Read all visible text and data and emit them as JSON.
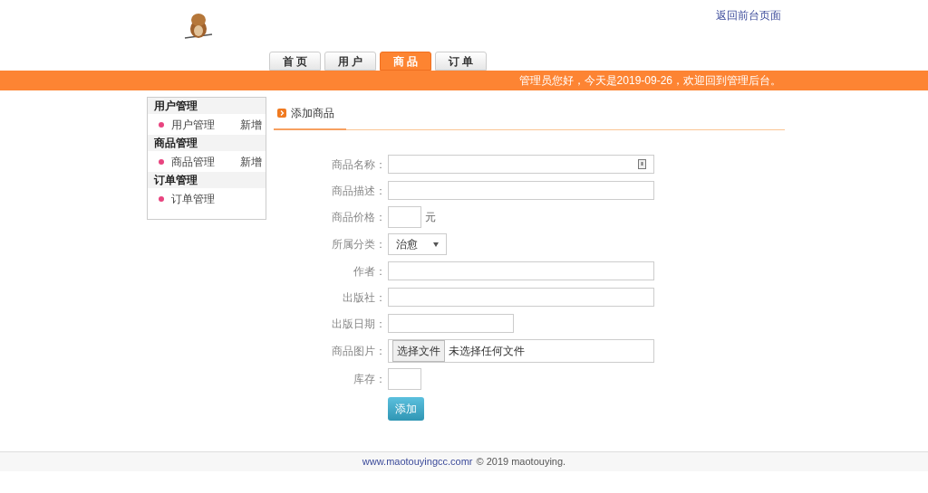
{
  "header": {
    "back_link": "返回前台页面"
  },
  "tabs": [
    {
      "label": "首 页",
      "selected": false
    },
    {
      "label": "用 户",
      "selected": false
    },
    {
      "label": "商 品",
      "selected": true
    },
    {
      "label": "订 单",
      "selected": false
    }
  ],
  "banner": "管理员您好，今天是2019-09-26，欢迎回到管理后台。",
  "sidebar": [
    {
      "title": "用户管理",
      "items": [
        {
          "label": "用户管理",
          "action": "新增"
        }
      ]
    },
    {
      "title": "商品管理",
      "items": [
        {
          "label": "商品管理",
          "action": "新增"
        }
      ]
    },
    {
      "title": "订单管理",
      "items": [
        {
          "label": "订单管理"
        }
      ]
    }
  ],
  "section_title": "添加商品",
  "form": [
    {
      "kind": "text",
      "label": "商品名称："
    },
    {
      "kind": "text",
      "label": "商品描述："
    },
    {
      "kind": "short",
      "label": "商品价格：",
      "unit": "元"
    },
    {
      "kind": "select",
      "label": "所属分类：",
      "value": "治愈"
    },
    {
      "kind": "text",
      "label": "作者："
    },
    {
      "kind": "text",
      "label": "出版社："
    },
    {
      "kind": "date",
      "label": "出版日期："
    },
    {
      "kind": "file",
      "label": "商品图片：",
      "button": "选择文件",
      "status": "未选择任何文件"
    },
    {
      "kind": "short",
      "label": "库存："
    }
  ],
  "submit": "添加",
  "footer": {
    "link": "www.maotouyingcc.comr",
    "text": "© 2019 maotouying."
  }
}
